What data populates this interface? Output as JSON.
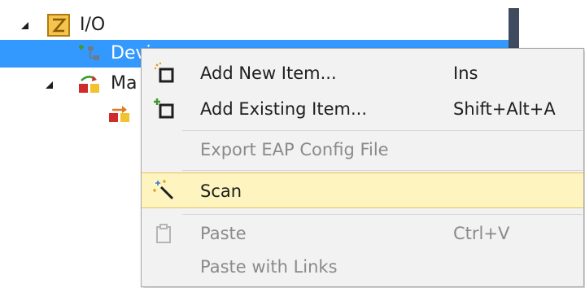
{
  "tree": {
    "items": [
      {
        "label": "I/O"
      },
      {
        "label": "Devi"
      },
      {
        "label": "Ma"
      },
      {
        "label": ""
      }
    ]
  },
  "context_menu": {
    "items": [
      {
        "label": "Add New Item...",
        "shortcut": "Ins",
        "icon": "add-new-item-icon",
        "enabled": true
      },
      {
        "label": "Add Existing Item...",
        "shortcut": "Shift+Alt+A",
        "icon": "add-existing-item-icon",
        "enabled": true
      },
      {
        "label": "Export EAP Config File",
        "shortcut": "",
        "icon": "",
        "enabled": false
      },
      {
        "label": "Scan",
        "shortcut": "",
        "icon": "magic-wand-icon",
        "enabled": true,
        "highlighted": true
      },
      {
        "label": "Paste",
        "shortcut": "Ctrl+V",
        "icon": "paste-icon",
        "enabled": false
      },
      {
        "label": "Paste with Links",
        "shortcut": "",
        "icon": "",
        "enabled": false
      }
    ]
  },
  "colors": {
    "selection": "#3399ff",
    "menu_background": "#f2f2f2",
    "menu_highlight": "#fdf4bf",
    "disabled_text": "#8a8a8a",
    "scrollbar": "#3f4a5e"
  }
}
